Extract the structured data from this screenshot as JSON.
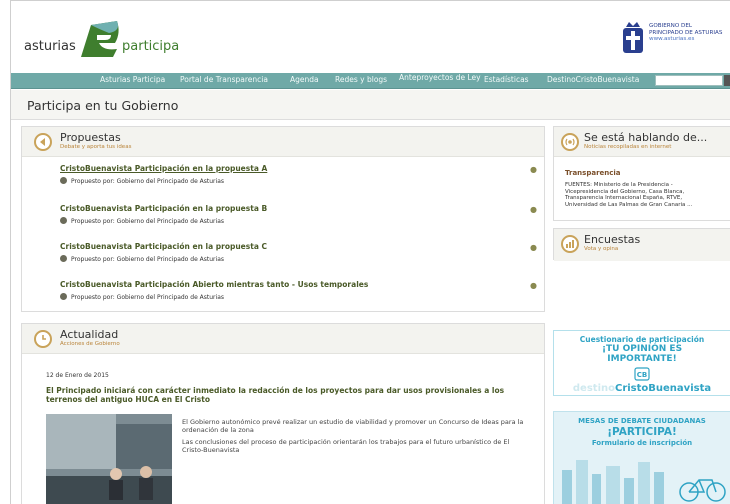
{
  "header": {
    "logo_word1": "asturias",
    "logo_word2": "participa",
    "gov_line1": "GOBIERNO DEL",
    "gov_line2": "PRINCIPADO DE ASTURIAS",
    "gov_url": "www.asturias.es"
  },
  "nav": {
    "items": [
      "Asturias Participa",
      "Portal de Transparencia",
      "Agenda",
      "Redes y blogs",
      "Anteproyectos de Ley",
      "Estadísticas",
      "DestinoCristoBuenavista"
    ],
    "search_placeholder": ""
  },
  "page_title": "Participa en tu Gobierno",
  "propuestas": {
    "title": "Propuestas",
    "subtitle": "Debate y aporta tus ideas",
    "by_label": "Propuesto por:",
    "items": [
      {
        "title": "CristoBuenavista Participación en la propuesta A",
        "author": "Gobierno del Principado de Asturias"
      },
      {
        "title": "CristoBuenavista Participación en la propuesta B",
        "author": "Gobierno del Principado de Asturias"
      },
      {
        "title": "CristoBuenavista Participación en la propuesta C",
        "author": "Gobierno del Principado de Asturias"
      },
      {
        "title": "CristoBuenavista Participación Abierto mientras tanto - Usos temporales",
        "author": "Gobierno del Principado de Asturias"
      }
    ]
  },
  "actualidad": {
    "title": "Actualidad",
    "subtitle": "Acciones de Gobierno",
    "date": "12 de Enero de 2015",
    "headline": "El Principado iniciará con carácter inmediato la redacción de los proyectos para dar usos provisionales a los terrenos del antiguo HUCA en El Cristo",
    "para1": "El Gobierno autonómico prevé realizar un estudio de viabilidad y promover un Concurso de Ideas para la ordenación de la zona",
    "para2": "Las conclusiones del proceso de participación orientarán los trabajos para el futuro urbanístico de El Cristo-Buenavista"
  },
  "hablando": {
    "title": "Se está hablando de...",
    "subtitle": "Noticias recopiladas en internet",
    "topic": "Transparencia",
    "sources": "FUENTES: Ministerio de la Presidencia - Vicepresidencia del Gobierno, Casa Blanca, Transparencia Internacional España, RTVE, Universidad de Las Palmas de Gran Canaria ..."
  },
  "encuestas": {
    "title": "Encuestas",
    "subtitle": "Vota y opina"
  },
  "banner1": {
    "line1": "Cuestionario de participación",
    "line2": "¡TU OPINIÓN ES",
    "line3": "IMPORTANTE!",
    "brand_prefix": "destino",
    "brand_bold": "CristoBuenavista"
  },
  "banner2": {
    "line1": "MESAS DE DEBATE CIUDADANAS",
    "line2": "¡PARTICIPA!",
    "line3": "Formulario de inscripción"
  },
  "colors": {
    "nav": "#6fa9a7",
    "link": "#4a5a28",
    "accent": "#c9a35a",
    "banner": "#2fa3c4"
  }
}
